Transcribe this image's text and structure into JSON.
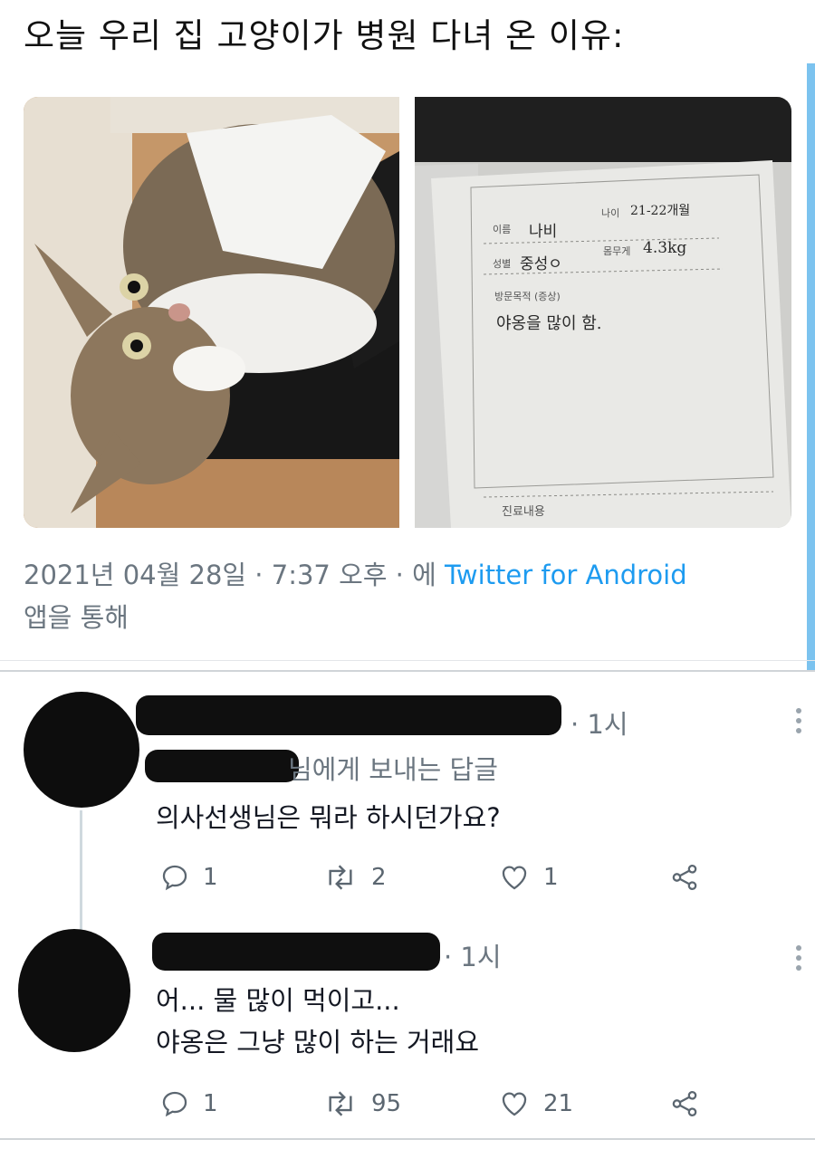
{
  "post": {
    "title": "오늘 우리 집 고양이가 병원 다녀 온 이유:",
    "meta_prefix": "2021년 04월 28일 · 7:37 오후 · 에 ",
    "meta_app": "Twitter for Android",
    "meta_suffix": "앱을 통해"
  },
  "chart_photo": {
    "name_label": "이름",
    "name_value": "나비",
    "age_label": "나이",
    "age_value": "21-22개월",
    "sex_label": "성별",
    "sex_value": "중성ㅇ",
    "weight_label": "몸무게",
    "weight_value": "4.3kg",
    "purpose_label": "방문목적 (증상)",
    "purpose_value": "야옹을 많이 함.",
    "treatment_label": "진료내용"
  },
  "replies": [
    {
      "time": "· 1시",
      "reply_to": "님에게 보내는 답글",
      "lines": [
        "의사선생님은 뭐라 하시던가요?"
      ],
      "reply_count": "1",
      "retweet_count": "2",
      "like_count": "1"
    },
    {
      "time": "· 1시",
      "lines": [
        "어... 물 많이 먹이고...",
        "야옹은 그냥 많이 하는 거래요"
      ],
      "reply_count": "1",
      "retweet_count": "95",
      "like_count": "21"
    }
  ],
  "colors": {
    "link": "#1d9bf0",
    "muted": "#6b7680",
    "accent": "#7cc3ef"
  },
  "icons": [
    "reply-icon",
    "retweet-icon",
    "like-icon",
    "share-icon",
    "more-icon"
  ]
}
